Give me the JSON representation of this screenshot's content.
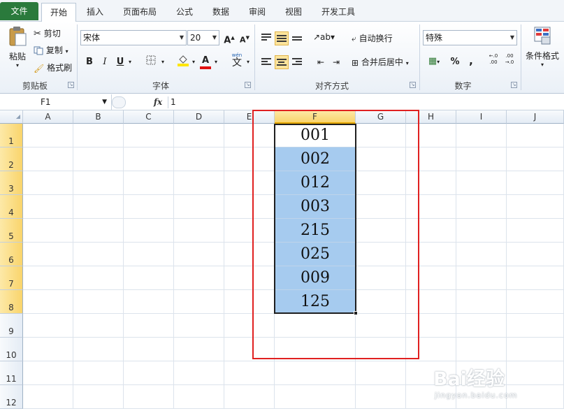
{
  "menu": {
    "tabs": [
      "文件",
      "开始",
      "插入",
      "页面布局",
      "公式",
      "数据",
      "审阅",
      "视图",
      "开发工具"
    ],
    "active": "开始"
  },
  "ribbon": {
    "clipboard": {
      "label": "剪贴板",
      "paste": "粘贴",
      "cut": "剪切",
      "copy": "复制",
      "format_painter": "格式刷"
    },
    "font": {
      "label": "字体",
      "font_name": "宋体",
      "font_size": "20",
      "grow": "A",
      "shrink": "A",
      "bold": "B",
      "italic": "I",
      "underline": "U",
      "font_color_glyph": "A",
      "wen": "wén",
      "wen_char": "文"
    },
    "alignment": {
      "label": "对齐方式",
      "wrap": "自动换行",
      "merge": "合并后居中"
    },
    "number": {
      "label": "数字",
      "format": "特殊",
      "percent": "%",
      "comma": ",",
      "inc_decimal": "←.0\n.00",
      "dec_decimal": ".00\n→.0"
    },
    "styles": {
      "conditional": "条件格式"
    },
    "colors": {
      "fill_color": "#ffe600",
      "font_color": "#e01010",
      "accent": "#2a7a3c"
    }
  },
  "formula_bar": {
    "name_box": "F1",
    "fx": "fx",
    "content": "1"
  },
  "sheet": {
    "columns": [
      "A",
      "B",
      "C",
      "D",
      "E",
      "F",
      "G",
      "H",
      "I",
      "J"
    ],
    "selected_column": "F",
    "rows": [
      "1",
      "2",
      "3",
      "4",
      "5",
      "6",
      "7",
      "8",
      "9",
      "10",
      "11",
      "12"
    ],
    "selected_rows": [
      "1",
      "2",
      "3",
      "4",
      "5",
      "6",
      "7",
      "8"
    ],
    "f_values": [
      "001",
      "002",
      "012",
      "003",
      "215",
      "025",
      "009",
      "125"
    ]
  },
  "watermark": {
    "text": "Bai经验",
    "url": "jingyan.baidu.com"
  }
}
